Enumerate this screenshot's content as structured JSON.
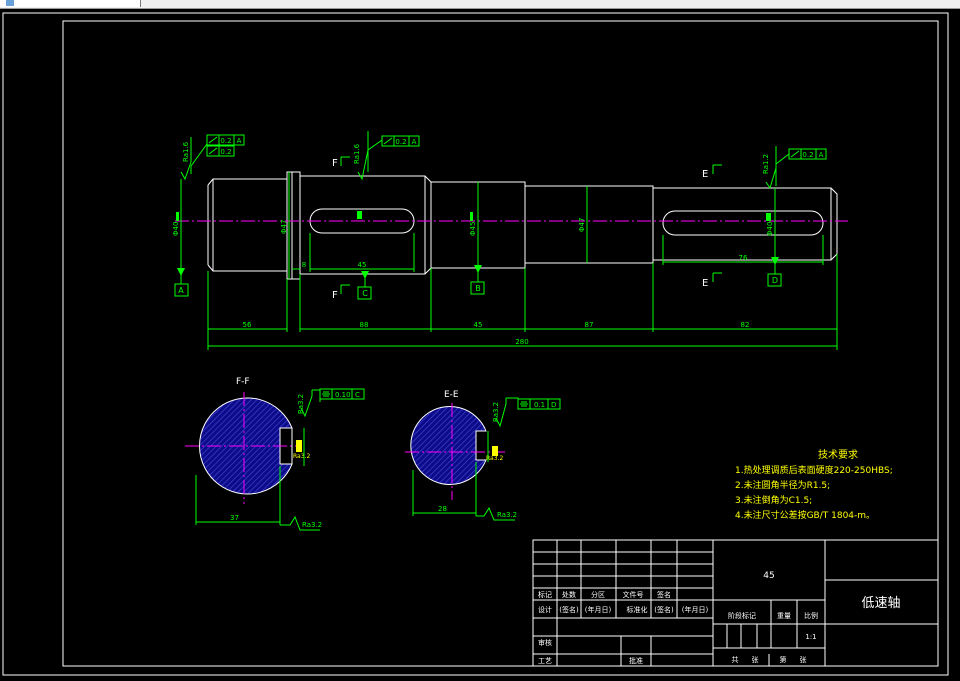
{
  "drawing": {
    "part_name": "低速轴",
    "material": "45",
    "scale": "1:1",
    "sections": {
      "ff": "F-F",
      "ee": "E-E"
    },
    "cut_labels": {
      "f_top": "F",
      "f_bottom": "F",
      "e_top": "E",
      "e_bottom": "E"
    },
    "datums": {
      "a": "A",
      "b": "B",
      "c": "C",
      "d": "D"
    },
    "dimensions": {
      "seg1": "56",
      "seg2": "88",
      "seg3": "45",
      "seg4": "87",
      "seg5": "82",
      "total": "280",
      "keyway1": "45",
      "keyway2": "76",
      "gap": "8",
      "sec_ff_depth": "37",
      "sec_ee_depth": "28"
    },
    "diameters": {
      "d1": "Φ40",
      "d2": "Φ47",
      "d3": "Φ45",
      "d4": "Φ47",
      "d5": "Φ40"
    },
    "surface_finish": {
      "s1": "Ra1.6",
      "s2": "Ra1.6",
      "s3": "Ra1.2",
      "kw_ff": "Ra3.2",
      "kw_ee": "Ra3.2",
      "bot_ff": "Ra3.2",
      "bot_ee": "Ra3.2"
    },
    "tolerances": {
      "t1_value": "0.2",
      "t1_datum": "A",
      "t2_value": "0.2",
      "t3_value": "0.2",
      "t3_datum": "A",
      "t4_value": "0.2",
      "t4_datum": "A",
      "sym_ff_value": "0.10",
      "sym_ff_datum": "C",
      "sym_ee_value": "0.1",
      "sym_ee_datum": "D"
    },
    "requirements": {
      "title": "技术要求",
      "items": [
        "1.热处理调质后表面硬度220-250HBS;",
        "2.未注圆角半径为R1.5;",
        "3.未注倒角为C1.5;",
        "4.未注尺寸公差按GB/T 1804-m。"
      ]
    },
    "title_block": {
      "headers": [
        "标记",
        "处数",
        "分区",
        "文件号",
        "签名"
      ],
      "design": "设计",
      "signature": "(签名)",
      "date": "(年月日)",
      "standard": "标准化",
      "signature2": "(签名)",
      "date2": "(年月日)",
      "stage": "阶段标记",
      "weight": "重量",
      "ratio": "比例",
      "review": "审核",
      "craft": "工艺",
      "approve": "批准",
      "total": "共",
      "sheets": "张",
      "page": "第",
      "sheet2": "张"
    }
  },
  "colors": {
    "background": "#000000",
    "outline": "#ffffff",
    "dimension": "#00ff00",
    "centerline": "#ff00ff",
    "hatch": "#0000aa",
    "annotation": "#ffff00"
  }
}
